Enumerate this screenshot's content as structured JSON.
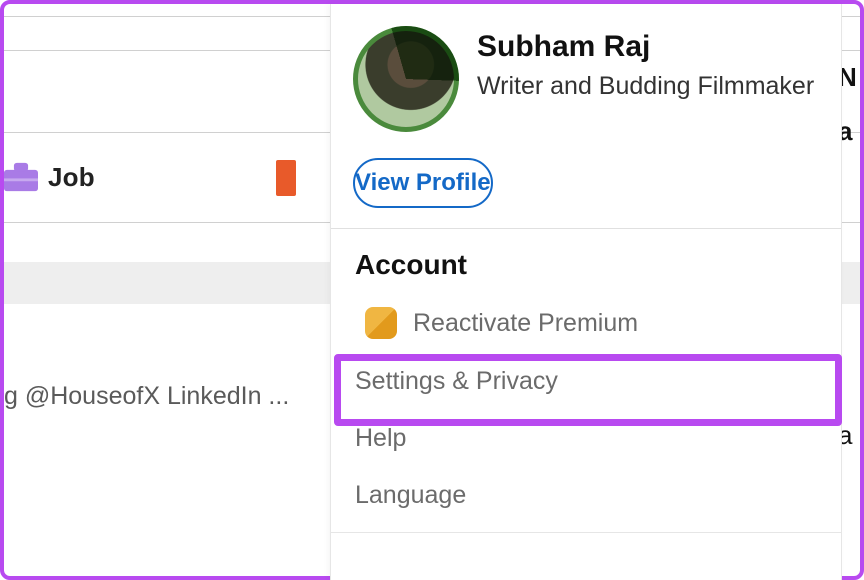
{
  "left": {
    "job_label": "Job",
    "bg_text": "g @HouseofX LinkedIn ..."
  },
  "right_bleed": {
    "r1": "N",
    "r2": "a",
    "r3": "'",
    "r4": ",",
    "r5": "a"
  },
  "panel": {
    "profile": {
      "name": "Subham Raj",
      "title": "Writer and Budding Filmmaker",
      "avatar_badge": "open-to-work"
    },
    "view_profile_label": "View Profile",
    "section_title": "Account",
    "menu": {
      "reactivate_premium": "Reactivate Premium",
      "settings_privacy": "Settings & Privacy",
      "help": "Help",
      "language": "Language"
    }
  },
  "colors": {
    "accent_blue": "#1469c7",
    "annotation_purple": "#b84af0",
    "premium_gold": "#e8a62a"
  }
}
